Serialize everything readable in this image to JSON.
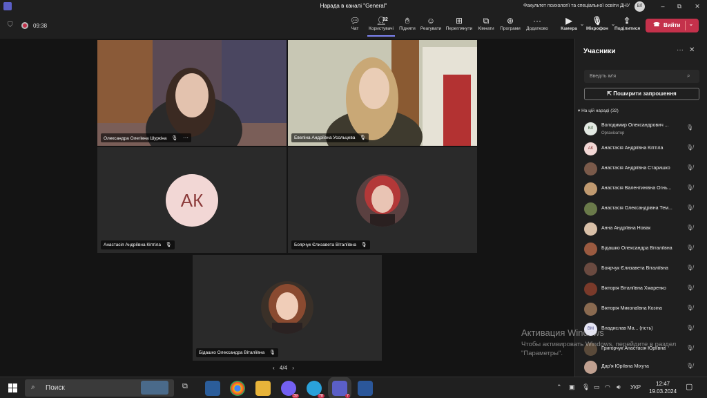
{
  "titlebar": {
    "title": "Нарада в каналі \"General\"",
    "org": "Факультет психології та спеціальної освіти ДНУ",
    "avatar_initials": "ВЛ",
    "minimize": "–",
    "maximize": "⧉",
    "close": "✕"
  },
  "toolbar": {
    "timer": "09:38",
    "participant_count": "32",
    "buttons": {
      "chat": "Чат",
      "people": "Користувачі",
      "raise": "Підняти",
      "react": "Реагувати",
      "view": "Переглянути",
      "rooms": "Кімнати",
      "apps": "Програми",
      "more": "Додатково",
      "camera": "Камера",
      "mic": "Мікрофон",
      "share": "Поділитися"
    },
    "leave": "Вийти"
  },
  "stage": {
    "tiles": [
      {
        "name": "Олександра Олегівна Шуркіна"
      },
      {
        "name": "Евеліна Андріївна Усольцева"
      },
      {
        "name": "Анастасія Андріївна Кіптіла",
        "initials": "АК"
      },
      {
        "name": "Боярчук Єлизавета Віталіївна"
      },
      {
        "name": "Бідашко Олександра Віталіївна"
      }
    ],
    "pager": "4/4"
  },
  "panel": {
    "title": "Учасники",
    "search_placeholder": "Введіть ім'я",
    "share_invite": "Поширити запрошення",
    "section": "На цій нараді (32)",
    "participants": [
      {
        "name": "Володимир Олександрович ...",
        "role": "Організатор",
        "initials": "ВЛ"
      },
      {
        "name": "Анастасія Андріївна Кіптіла",
        "initials": "АК"
      },
      {
        "name": "Анастасія Андріївна Старишко"
      },
      {
        "name": "Анастасія Валентинівна Огнь..."
      },
      {
        "name": "Анастасія Олександрівна Тем..."
      },
      {
        "name": "Анна Андріївна Новак"
      },
      {
        "name": "Бідашко Олександра Віталіївна"
      },
      {
        "name": "Боярчук Єлизавета Віталіївна"
      },
      {
        "name": "Вікторія Віталіївна Хмаренко"
      },
      {
        "name": "Вікторія Миколаївна Козіна"
      },
      {
        "name": "Владислав Ма... (гість)",
        "initials": "ВМ"
      },
      {
        "name": "Григорчук Анастасія Юріївна"
      },
      {
        "name": "Дар'я Юріївна Міхута"
      }
    ]
  },
  "watermark": {
    "line1": "Активация Windows",
    "line2": "Чтобы активировать Windows, перейдите в раздел \"Параметры\"."
  },
  "taskbar": {
    "search": "Поиск",
    "badges": {
      "viber": "39",
      "telegram": "78",
      "teams": "7"
    },
    "lang": "УКР",
    "time": "12:47",
    "date": "19.03.2024"
  },
  "colors": {
    "accent": "#5b5fc7",
    "leave": "#c4314b",
    "panel_bg": "#1f1f1f",
    "stage_bg": "#141414"
  }
}
